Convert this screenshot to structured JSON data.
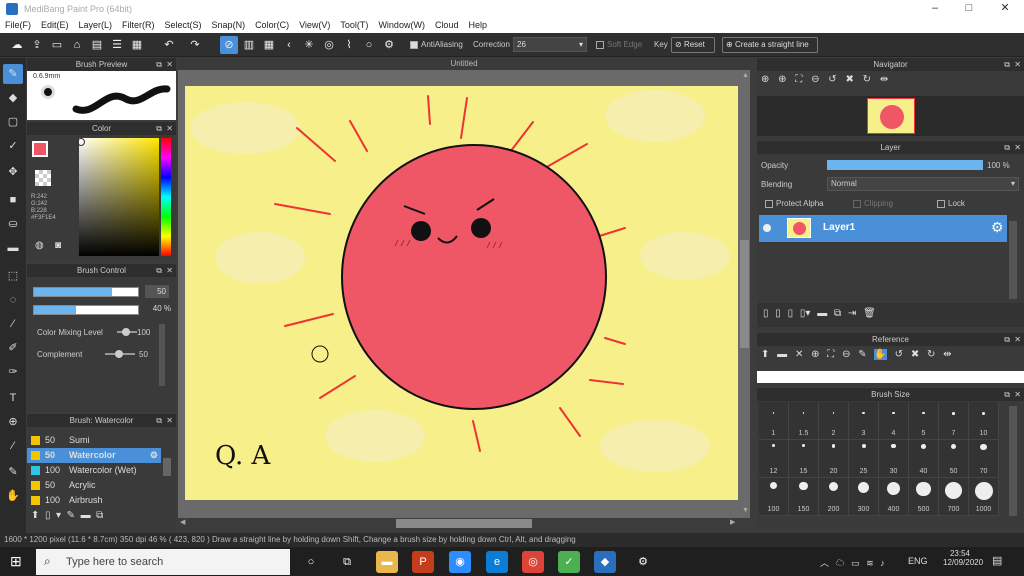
{
  "window": {
    "title": "MediBang Paint Pro (64bit)"
  },
  "menu": [
    "File(F)",
    "Edit(E)",
    "Layer(L)",
    "Filter(R)",
    "Select(S)",
    "Snap(N)",
    "Color(C)",
    "View(V)",
    "Tool(T)",
    "Window(W)",
    "Cloud",
    "Help"
  ],
  "toolbar": {
    "antialiasing": "AntiAliasing",
    "correction_label": "Correction",
    "correction_value": "26",
    "soft_edge": "Soft Edge",
    "key_label": "Key",
    "reset": "Reset",
    "straight_line": "Create a straight line"
  },
  "brush_preview": {
    "title": "Brush Preview",
    "size": "0.6.9mm"
  },
  "color_panel": {
    "title": "Color",
    "values": [
      "R:242",
      "G:242",
      "B:228",
      "#F3F1E4"
    ],
    "fg": "#f05566",
    "bg": "#2ec4b6"
  },
  "brush_control": {
    "title": "Brush Control",
    "size_value": "50",
    "opacity_value": "40 %",
    "mixing_label": "Color Mixing Level",
    "mixing_value": "100",
    "complement_label": "Complement",
    "complement_value": "50",
    "size_fill": 0.75,
    "opacity_fill": 0.4
  },
  "brush_list": {
    "title": "Brush: Watercolor",
    "items": [
      {
        "size": "50",
        "name": "Sumi",
        "color": "#f2c500"
      },
      {
        "size": "50",
        "name": "Watercolor",
        "color": "#f2c500",
        "selected": true
      },
      {
        "size": "100",
        "name": "Watercolor (Wet)",
        "color": "#2ec4e6"
      },
      {
        "size": "50",
        "name": "Acrylic",
        "color": "#f2c500"
      },
      {
        "size": "100",
        "name": "Airbrush",
        "color": "#f2c500"
      }
    ]
  },
  "canvas": {
    "tab": "Untitled",
    "handwriting": "Q. A"
  },
  "navigator": {
    "title": "Navigator"
  },
  "layer_panel": {
    "title": "Layer",
    "opacity_label": "Opacity",
    "opacity_value": "100 %",
    "blending_label": "Blending",
    "blending_value": "Normal",
    "protect_alpha": "Protect Alpha",
    "clipping": "Clipping",
    "lock": "Lock",
    "layer_name": "Layer1"
  },
  "reference": {
    "title": "Reference"
  },
  "brush_size": {
    "title": "Brush Size",
    "sizes": [
      "1",
      "1.5",
      "2",
      "3",
      "4",
      "5",
      "7",
      "10",
      "12",
      "15",
      "20",
      "25",
      "30",
      "40",
      "50",
      "70",
      "100",
      "150",
      "200",
      "300",
      "400",
      "500",
      "700",
      "1000"
    ]
  },
  "status": {
    "text": "1600 * 1200 pixel   (11.6 * 8.7cm)   350 dpi   46 %   ( 423, 820 )   Draw a straight line by holding down Shift, Change a brush size by holding down Ctrl, Alt, and dragging"
  },
  "taskbar": {
    "search": "Type here to search",
    "time": "23:54",
    "date": "12/09/2020",
    "lang": "ENG"
  }
}
